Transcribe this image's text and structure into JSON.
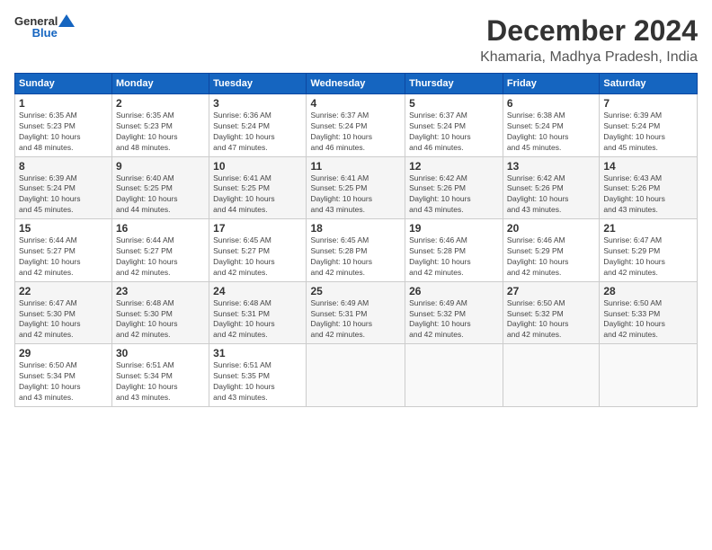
{
  "header": {
    "logo_general": "General",
    "logo_blue": "Blue",
    "month_title": "December 2024",
    "location": "Khamaria, Madhya Pradesh, India"
  },
  "weekdays": [
    "Sunday",
    "Monday",
    "Tuesday",
    "Wednesday",
    "Thursday",
    "Friday",
    "Saturday"
  ],
  "weeks": [
    [
      {
        "day": 1,
        "sunrise": "6:35 AM",
        "sunset": "5:23 PM",
        "daylight": "10 hours and 48 minutes."
      },
      {
        "day": 2,
        "sunrise": "6:35 AM",
        "sunset": "5:23 PM",
        "daylight": "10 hours and 48 minutes."
      },
      {
        "day": 3,
        "sunrise": "6:36 AM",
        "sunset": "5:24 PM",
        "daylight": "10 hours and 47 minutes."
      },
      {
        "day": 4,
        "sunrise": "6:37 AM",
        "sunset": "5:24 PM",
        "daylight": "10 hours and 46 minutes."
      },
      {
        "day": 5,
        "sunrise": "6:37 AM",
        "sunset": "5:24 PM",
        "daylight": "10 hours and 46 minutes."
      },
      {
        "day": 6,
        "sunrise": "6:38 AM",
        "sunset": "5:24 PM",
        "daylight": "10 hours and 45 minutes."
      },
      {
        "day": 7,
        "sunrise": "6:39 AM",
        "sunset": "5:24 PM",
        "daylight": "10 hours and 45 minutes."
      }
    ],
    [
      {
        "day": 8,
        "sunrise": "6:39 AM",
        "sunset": "5:24 PM",
        "daylight": "10 hours and 45 minutes."
      },
      {
        "day": 9,
        "sunrise": "6:40 AM",
        "sunset": "5:25 PM",
        "daylight": "10 hours and 44 minutes."
      },
      {
        "day": 10,
        "sunrise": "6:41 AM",
        "sunset": "5:25 PM",
        "daylight": "10 hours and 44 minutes."
      },
      {
        "day": 11,
        "sunrise": "6:41 AM",
        "sunset": "5:25 PM",
        "daylight": "10 hours and 43 minutes."
      },
      {
        "day": 12,
        "sunrise": "6:42 AM",
        "sunset": "5:26 PM",
        "daylight": "10 hours and 43 minutes."
      },
      {
        "day": 13,
        "sunrise": "6:42 AM",
        "sunset": "5:26 PM",
        "daylight": "10 hours and 43 minutes."
      },
      {
        "day": 14,
        "sunrise": "6:43 AM",
        "sunset": "5:26 PM",
        "daylight": "10 hours and 43 minutes."
      }
    ],
    [
      {
        "day": 15,
        "sunrise": "6:44 AM",
        "sunset": "5:27 PM",
        "daylight": "10 hours and 42 minutes."
      },
      {
        "day": 16,
        "sunrise": "6:44 AM",
        "sunset": "5:27 PM",
        "daylight": "10 hours and 42 minutes."
      },
      {
        "day": 17,
        "sunrise": "6:45 AM",
        "sunset": "5:27 PM",
        "daylight": "10 hours and 42 minutes."
      },
      {
        "day": 18,
        "sunrise": "6:45 AM",
        "sunset": "5:28 PM",
        "daylight": "10 hours and 42 minutes."
      },
      {
        "day": 19,
        "sunrise": "6:46 AM",
        "sunset": "5:28 PM",
        "daylight": "10 hours and 42 minutes."
      },
      {
        "day": 20,
        "sunrise": "6:46 AM",
        "sunset": "5:29 PM",
        "daylight": "10 hours and 42 minutes."
      },
      {
        "day": 21,
        "sunrise": "6:47 AM",
        "sunset": "5:29 PM",
        "daylight": "10 hours and 42 minutes."
      }
    ],
    [
      {
        "day": 22,
        "sunrise": "6:47 AM",
        "sunset": "5:30 PM",
        "daylight": "10 hours and 42 minutes."
      },
      {
        "day": 23,
        "sunrise": "6:48 AM",
        "sunset": "5:30 PM",
        "daylight": "10 hours and 42 minutes."
      },
      {
        "day": 24,
        "sunrise": "6:48 AM",
        "sunset": "5:31 PM",
        "daylight": "10 hours and 42 minutes."
      },
      {
        "day": 25,
        "sunrise": "6:49 AM",
        "sunset": "5:31 PM",
        "daylight": "10 hours and 42 minutes."
      },
      {
        "day": 26,
        "sunrise": "6:49 AM",
        "sunset": "5:32 PM",
        "daylight": "10 hours and 42 minutes."
      },
      {
        "day": 27,
        "sunrise": "6:50 AM",
        "sunset": "5:32 PM",
        "daylight": "10 hours and 42 minutes."
      },
      {
        "day": 28,
        "sunrise": "6:50 AM",
        "sunset": "5:33 PM",
        "daylight": "10 hours and 42 minutes."
      }
    ],
    [
      {
        "day": 29,
        "sunrise": "6:50 AM",
        "sunset": "5:34 PM",
        "daylight": "10 hours and 43 minutes."
      },
      {
        "day": 30,
        "sunrise": "6:51 AM",
        "sunset": "5:34 PM",
        "daylight": "10 hours and 43 minutes."
      },
      {
        "day": 31,
        "sunrise": "6:51 AM",
        "sunset": "5:35 PM",
        "daylight": "10 hours and 43 minutes."
      },
      null,
      null,
      null,
      null
    ]
  ]
}
